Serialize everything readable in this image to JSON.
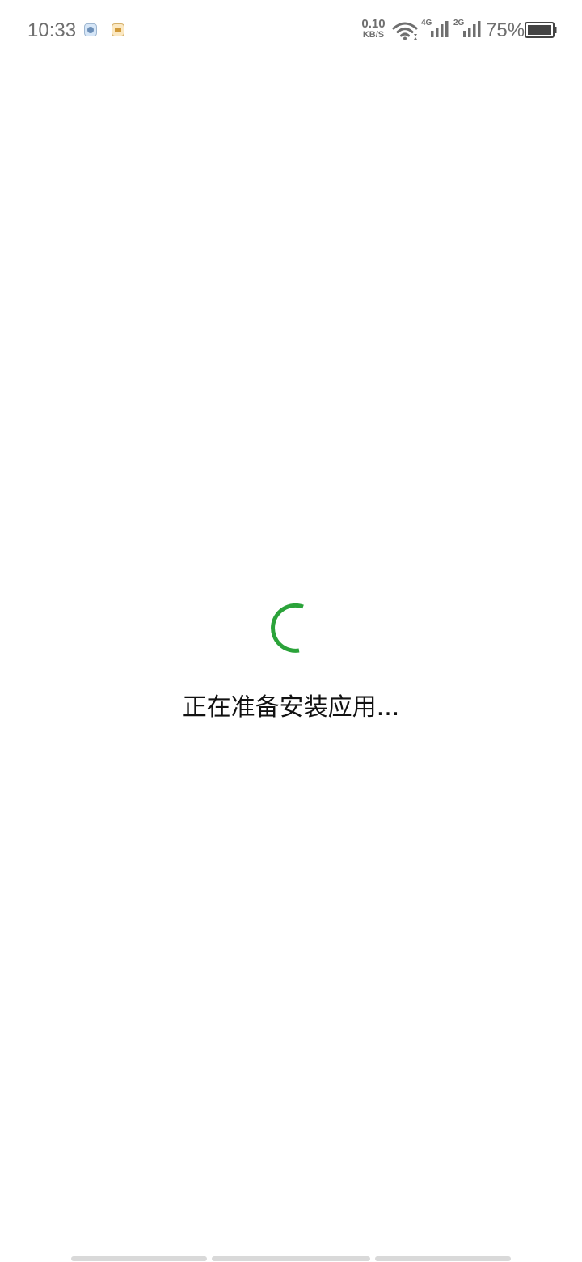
{
  "status_bar": {
    "time": "10:33",
    "notification_icons": [
      "app-notification-icon",
      "file-notification-icon"
    ],
    "net_speed_value": "0.10",
    "net_speed_unit": "KB/S",
    "sim1_network": "4G",
    "sim2_network": "2G",
    "battery_percent": "75%",
    "battery_level": 0.75,
    "icons": [
      "wifi-icon",
      "signal-icon",
      "signal-icon",
      "battery-icon"
    ]
  },
  "main": {
    "spinner_color": "#2ba33a",
    "message": "正在准备安装应用..."
  },
  "navigation": {
    "gesture_bars": 3,
    "bar_color": "#d9d9d9"
  },
  "colors": {
    "background": "#ffffff",
    "status_text": "#6f6f6f",
    "accent": "#2ba33a",
    "text": "#111111"
  }
}
